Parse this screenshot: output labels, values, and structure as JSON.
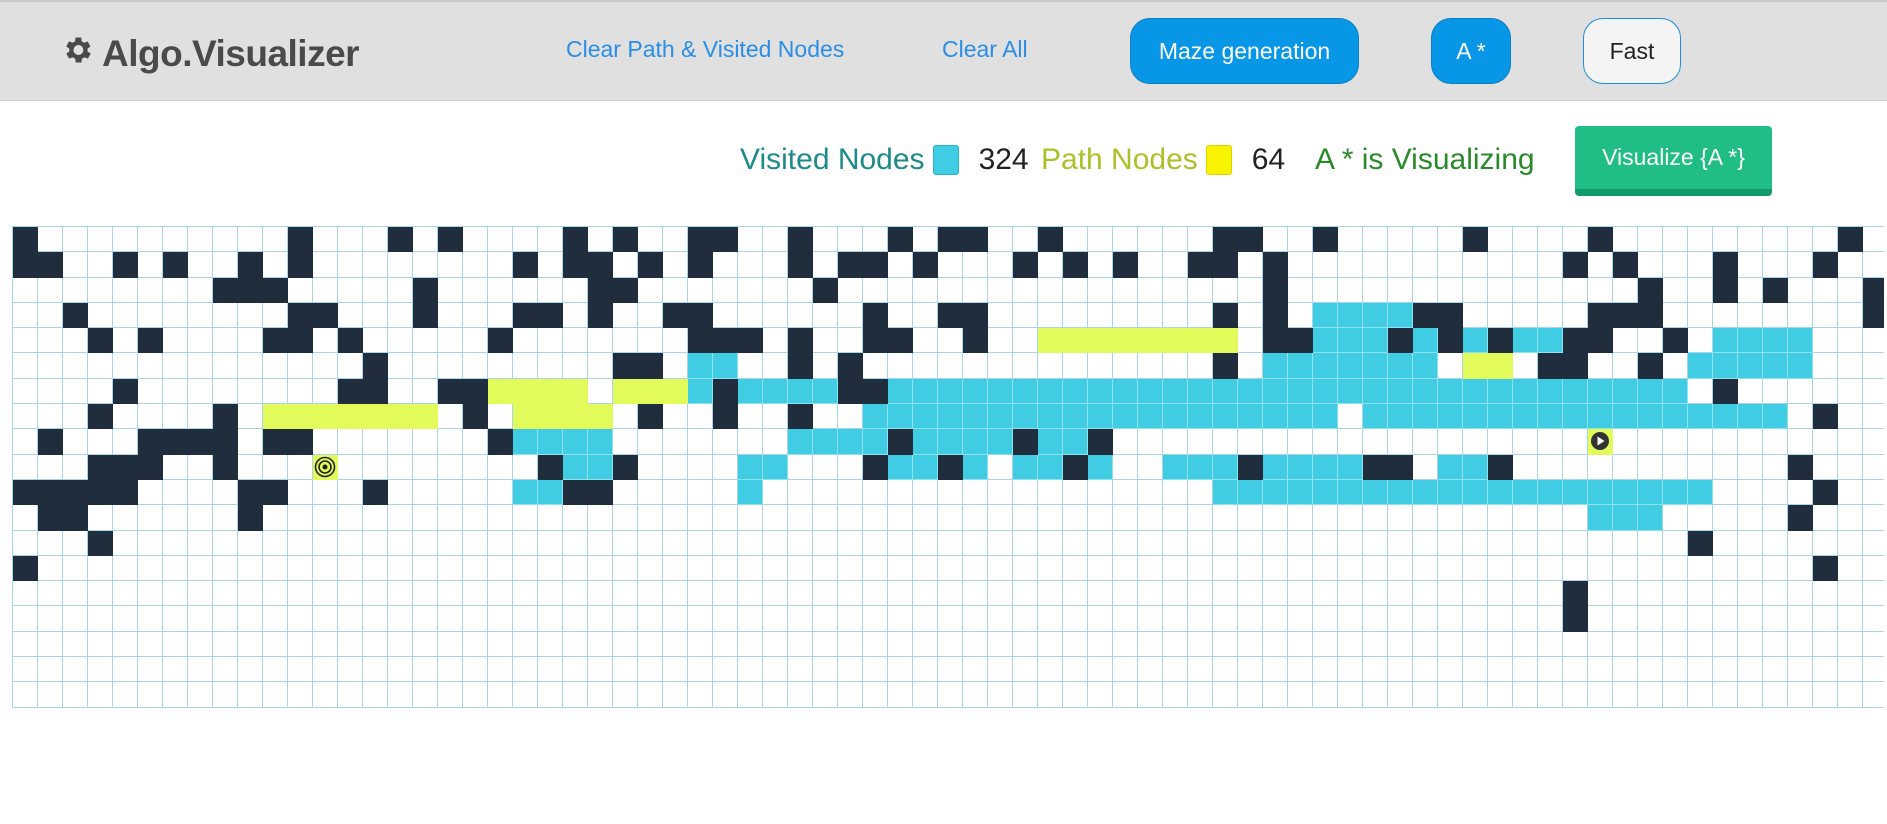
{
  "navbar": {
    "brand_icon": "gear-icon",
    "brand": "Algo.Visualizer",
    "clear_path_label": "Clear Path & Visited Nodes",
    "clear_all_label": "Clear All",
    "maze_label": "Maze generation",
    "algorithm_label": "A *",
    "speed_label": "Fast"
  },
  "legend": {
    "visited_label": "Visited Nodes",
    "visited_count": "324",
    "path_label": "Path Nodes",
    "path_count": "64",
    "status": "A * is Visualizing",
    "visualize_label": "Visualize {A *}"
  },
  "colors": {
    "visited": "#40cde3",
    "path": "#e2fb5a",
    "wall": "#1f2d3d",
    "accent": "#0896e6",
    "visualize": "#20bd85"
  },
  "grid": {
    "columns": 75,
    "rows": 19,
    "start_icon": "play-icon",
    "target_icon": "target-icon",
    "start": [
      8,
      63
    ],
    "target": [
      9,
      12
    ],
    "legend_key": "#=wall, v=visited, p=path, .=empty",
    "cells": [
      "#..........#...#.#....#.#..##..#...#.##..#......##..#.....#....#.........#.",
      "##..#.#..#.#........#.##.#.#...#.##.#...#.#.#..##.#...........#.#...#...#..",
      "........###.....#......##.......#.................#..............#..#.#...#",
      "..#........##...#...##.#..##......#..##.........#.#.vvvv##.....###........#",
      "...#.#....##.#.....#.......###.#..##..#..pppppppp.##vvv#v#v#vv##..#.vvvv.....#",
      "..............#.........##.vv..#.#..............#.vvvvvvv.pp.##..#.vvvvv....",
      "....#........##..##pppp.pppv#vvvv##vvvvvvvvvvvvvvvvvvvvvvvvvvvvvvvv.#....",
      "...#....#.ppppppp.#.pppp.#..#..#..vvvvvvvvvvvvvvvvvvv.vvvvvvvvvvvvvvvvv.#",
      ".#...####.##.......#vvvv.......vvvv#vvvv#vv#..........................",
      "...###..#...#........#vv#....vv...#vv#v.vv#v..vvv#vvvv##.vv#...........#",
      "#####....##...#.....vv##.....v..................vvvvvvvvvvvvvvvvvvvv....#",
      ".##......#.....................................................vvv.....#",
      "...#...............................................................#.....",
      "#.......................................................................#",
      "..............................................................#.........",
      "..............................................................#.........",
      "........................................................................",
      "........................................................................",
      "........................................................................"
    ]
  }
}
